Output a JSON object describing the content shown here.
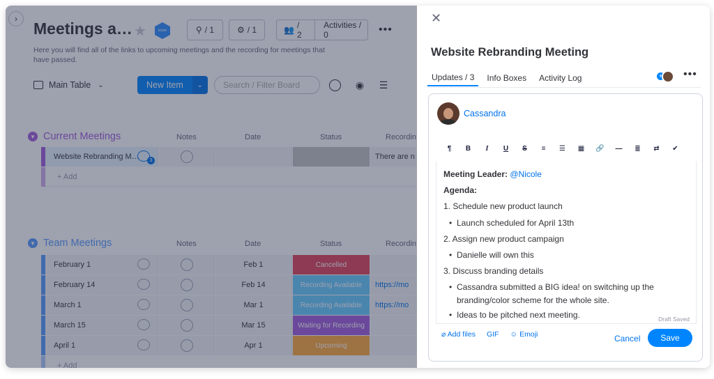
{
  "board": {
    "title": "Meetings a…",
    "description": "Here you will find all of the links to upcoming meetings and the recording for meetings that have passed.",
    "zoom_label": "zoom",
    "integrations_count": "/ 1",
    "automations_count": "/ 1",
    "members_count": "/ 2",
    "activities_label": "Activities / 0"
  },
  "toolbar": {
    "view_label": "Main Table",
    "new_item_label": "New Item",
    "search_placeholder": "Search / Filter Board"
  },
  "columns": {
    "notes": "Notes",
    "date": "Date",
    "status": "Status",
    "recording": "Recordin"
  },
  "groups": {
    "current": {
      "title": "Current Meetings",
      "color": "#a25ddc",
      "rows": [
        {
          "name": "Website Rebranding M…",
          "date": "",
          "status": "",
          "recording": "There are n",
          "updates": "3"
        }
      ],
      "add_label": "+ Add"
    },
    "team": {
      "title": "Team Meetings",
      "color": "#579bfc",
      "rows": [
        {
          "name": "February 1",
          "date": "Feb 1",
          "status": "Cancelled",
          "status_color": "#e2445c",
          "recording": ""
        },
        {
          "name": "February 14",
          "date": "Feb 14",
          "status": "Recording Available",
          "status_color": "#66ccff",
          "recording": "https://mo"
        },
        {
          "name": "March 1",
          "date": "Mar 1",
          "status": "Recording Available",
          "status_color": "#66ccff",
          "recording": "https://mo"
        },
        {
          "name": "March 15",
          "date": "Mar 15",
          "status": "Waiting for Recording",
          "status_color": "#a25ddc",
          "recording": ""
        },
        {
          "name": "April 1",
          "date": "Apr 1",
          "status": "Upcoming",
          "status_color": "#fdab3d",
          "recording": ""
        }
      ],
      "add_label": "+ Add"
    }
  },
  "panel": {
    "title": "Website Rebranding Meeting",
    "tabs": [
      "Updates / 3",
      "Info Boxes",
      "Activity Log"
    ],
    "author": "Cassandra",
    "content": {
      "leader_label": "Meeting Leader:",
      "leader_mention": "@Nicole",
      "agenda_label": "Agenda:",
      "item1": "1. Schedule new product launch",
      "item1_b1": "Launch scheduled for April 13th",
      "item2": "2. Assign new product campaign",
      "item2_b1": "Danielle will own this",
      "item3": "3. Discuss branding details",
      "item3_b1": "Cassandra submitted a BIG idea! on switching up the branding/color scheme for the whole site.",
      "item3_b2": "Ideas to be pitched next meeting."
    },
    "draft_status": "Draft Saved",
    "add_files_label": "Add files",
    "gif_label": "GIF",
    "emoji_label": "Emoji",
    "cancel_label": "Cancel",
    "save_label": "Save"
  }
}
